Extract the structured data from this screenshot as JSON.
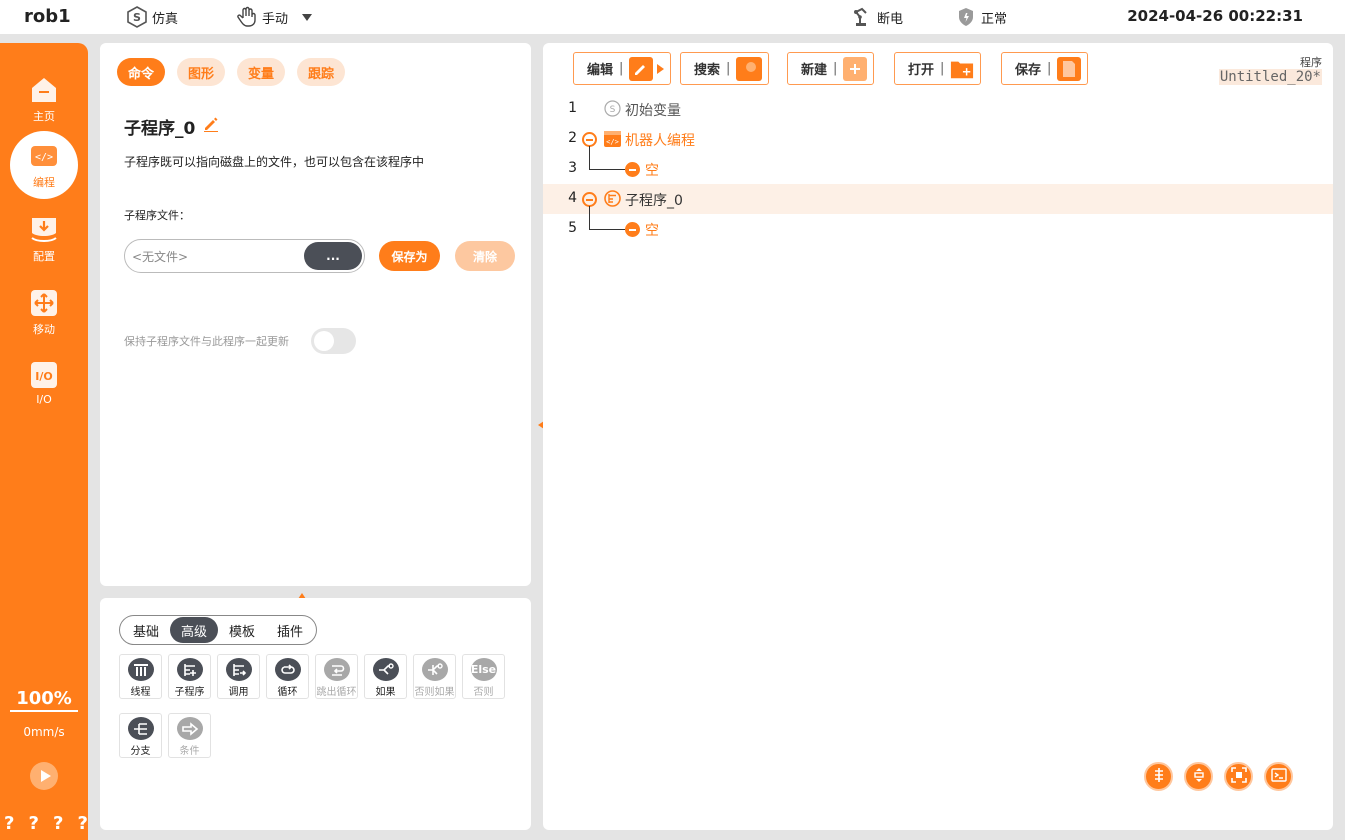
{
  "topbar": {
    "robot": "rob1",
    "sim_label": "仿真",
    "mode_label": "手动",
    "power_label": "断电",
    "safety_label": "正常",
    "datetime": "2024-04-26 00:22:31"
  },
  "sidebar": {
    "items": [
      {
        "label": "主页",
        "icon": "home-icon"
      },
      {
        "label": "编程",
        "icon": "code-icon"
      },
      {
        "label": "配置",
        "icon": "install-icon"
      },
      {
        "label": "移动",
        "icon": "move-icon"
      },
      {
        "label": "I/O",
        "icon": "io-icon"
      }
    ],
    "active_index": 1,
    "speed_percent": "100%",
    "speed_value": "0mm/s",
    "help": [
      "?",
      "?",
      "?",
      "?"
    ]
  },
  "command_panel": {
    "tabs": [
      "命令",
      "图形",
      "变量",
      "跟踪"
    ],
    "active_tab": 0,
    "title": "子程序_0",
    "description": "子程序既可以指向磁盘上的文件，也可以包含在该程序中",
    "file_label": "子程序文件：",
    "file_placeholder": "<无文件>",
    "browse_label": "...",
    "save_as_label": "保存为",
    "clear_label": "清除",
    "keep_sync_label": "保持子程序文件与此程序一起更新",
    "keep_sync_on": false
  },
  "palette": {
    "tabs": [
      "基础",
      "高级",
      "模板",
      "插件"
    ],
    "active_tab": 1,
    "items": [
      {
        "label": "线程",
        "enabled": true
      },
      {
        "label": "子程序",
        "enabled": true
      },
      {
        "label": "调用",
        "enabled": true
      },
      {
        "label": "循环",
        "enabled": true
      },
      {
        "label": "跳出循环",
        "enabled": false
      },
      {
        "label": "如果",
        "enabled": true
      },
      {
        "label": "否则如果",
        "enabled": false
      },
      {
        "label": "否则",
        "enabled": false,
        "glyph": "Else"
      },
      {
        "label": "分支",
        "enabled": true
      },
      {
        "label": "条件",
        "enabled": false
      }
    ]
  },
  "program_panel": {
    "toolbar": [
      {
        "label": "编辑",
        "icon": "edit-icon"
      },
      {
        "label": "搜索",
        "icon": "search-icon"
      },
      {
        "label": "新建",
        "icon": "new-icon"
      },
      {
        "label": "打开",
        "icon": "open-folder-icon"
      },
      {
        "label": "保存",
        "icon": "save-icon"
      }
    ],
    "program_label": "程序",
    "program_name": "Untitled_20*",
    "lines": [
      {
        "n": "1",
        "text": "初始变量"
      },
      {
        "n": "2",
        "text": "机器人编程"
      },
      {
        "n": "3",
        "text": "空"
      },
      {
        "n": "4",
        "text": "子程序_0"
      },
      {
        "n": "5",
        "text": "空"
      }
    ],
    "selected_line": 4
  },
  "colors": {
    "accent": "#ff7d1a",
    "accent_light": "#fde5d3",
    "dark_button": "#4b4f57",
    "selected_row": "#fdf0e6"
  }
}
